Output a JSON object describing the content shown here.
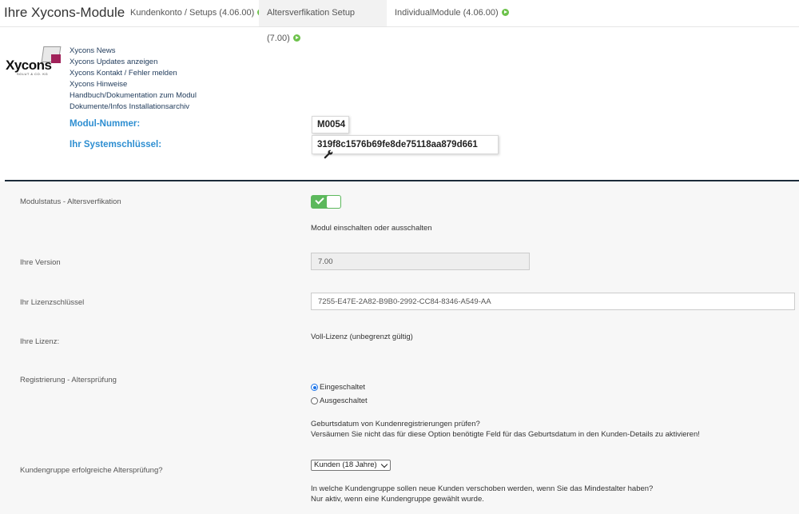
{
  "header": {
    "title": "Ihre Xycons-Module",
    "tabs": [
      {
        "label": "Kundenkonto / Setups (4.06.00)"
      },
      {
        "label": "Altersverfikation Setup (7.00)"
      },
      {
        "label": "IndividualModule (4.06.00)"
      }
    ]
  },
  "logo": {
    "text": "Xycons",
    "sub": "SOLUT & CO. KG"
  },
  "links": [
    "Xycons News",
    "Xycons Updates anzeigen",
    "Xycons Kontakt / Fehler melden",
    "Xycons Hinweise",
    "Handbuch/Dokumentation zum Modul",
    "Dokumente/Infos Installationsarchiv"
  ],
  "module_info": {
    "number_label": "Modul-Nummer:",
    "number_value": "M0054",
    "key_label": "Ihr Systemschlüssel:",
    "key_value": "319f8c1576b69fe8de75118aa879d661"
  },
  "settings": {
    "status_label": "Modulstatus - Altersverfikation",
    "status_hint": "Modul einschalten oder ausschalten",
    "version_label": "Ihre Version",
    "version_value": "7.00",
    "license_key_label": "Ihr Lizenzschlüssel",
    "license_key_value": "7255-E47E-2A82-B9B0-2992-CC84-8346-A549-AA",
    "license_label": "Ihre Lizenz:",
    "license_value": "Voll-Lizenz (unbegrenzt gültig)",
    "registration_label": "Registrierung - Altersprüfung",
    "radio_on": "Eingeschaltet",
    "radio_off": "Ausgeschaltet",
    "registration_hint_1": "Geburtsdatum von Kundenregistrierungen prüfen?",
    "registration_hint_2": "Versäumen Sie nicht das für diese Option benötigte Feld für das Geburtsdatum in den Kunden-Details zu aktivieren!",
    "group_label": "Kundengruppe erfolgreiche Altersprüfung?",
    "group_selected": "Kunden (18 Jahre)",
    "group_hint_1": "In welche Kundengruppe sollen neue Kunden verschoben werden, wenn Sie das Mindestalter haben?",
    "group_hint_2": "Nur aktiv, wenn eine Kundengruppe gewählt wurde."
  },
  "colors": {
    "accent_blue": "#2d8ed1",
    "toggle_green": "#5cb85c",
    "divider": "#1c2b3a",
    "logo_accent": "#a0225a"
  }
}
